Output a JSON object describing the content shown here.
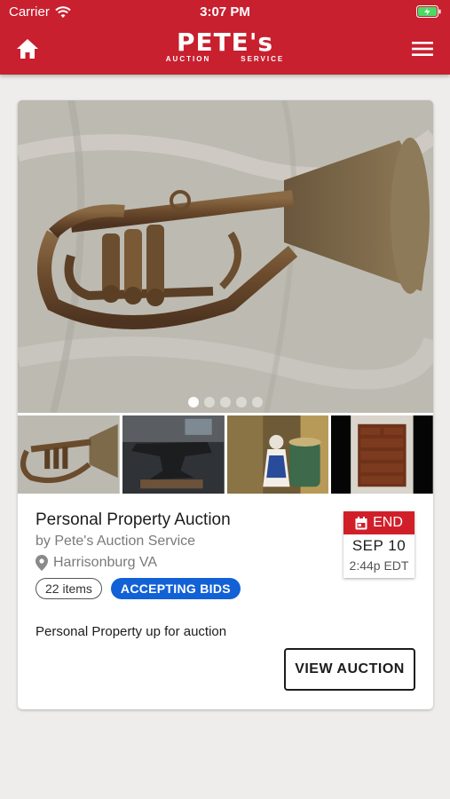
{
  "status_bar": {
    "carrier": "Carrier",
    "time": "3:07 PM"
  },
  "header": {
    "logo_main": "PETE's",
    "logo_sub_left": "AUCTION",
    "logo_sub_right": "SERVICE",
    "brand_color": "#c8202f"
  },
  "auction": {
    "title": "Personal Property Auction",
    "subtitle": "by Pete's Auction Service",
    "location": "Harrisonburg VA",
    "items_count": "22 items",
    "status": "ACCEPTING BIDS",
    "description": "Personal Property up for auction",
    "end_label": "END",
    "end_date": "SEP 10",
    "end_time": "2:44p EDT",
    "view_button": "VIEW AUCTION",
    "carousel_total": 5,
    "carousel_active": 1
  },
  "icons": {
    "home": "home-icon",
    "menu": "menu-icon",
    "wifi": "wifi-icon",
    "battery": "battery-charging-icon",
    "location": "map-pin-icon",
    "calendar": "calendar-icon"
  }
}
